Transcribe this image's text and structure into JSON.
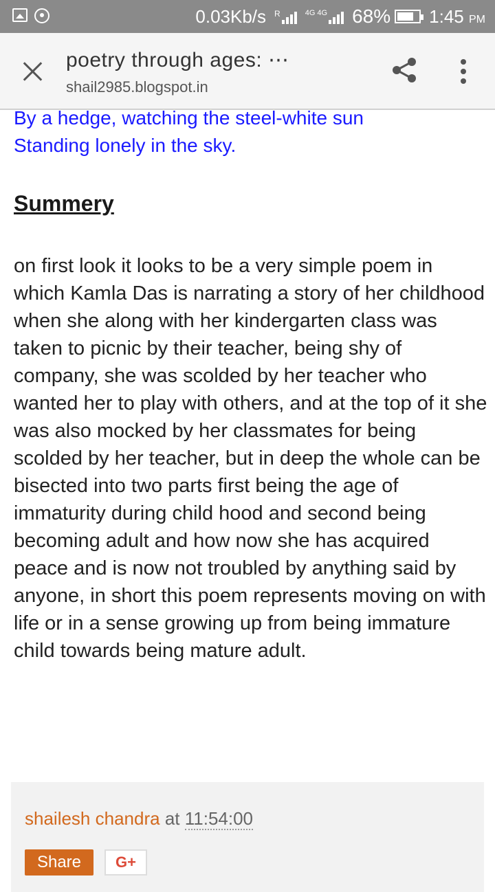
{
  "status_bar": {
    "speed": "0.03Kb/s",
    "sim1": "R",
    "sim2": "4G 4G",
    "battery": "68%",
    "battery_level": 0.68,
    "time": "1:45",
    "ampm": "PM",
    "icons": [
      "gallery-icon",
      "whatsapp-icon",
      "signal-icon",
      "battery-icon"
    ]
  },
  "header": {
    "title": "poetry through ages: ⋯",
    "url": "shail2985.blogspot.in",
    "icons": [
      "close-icon",
      "share-icon",
      "more-vert-icon"
    ]
  },
  "poem_lines": [
    "By a hedge, watching the steel-white sun",
    "Standing lonely in the sky."
  ],
  "section_title": "Summery",
  "summary": "on first look it looks to be a very simple poem in which Kamla Das is narrating a story of her childhood  when she along with her kindergarten class was taken to picnic by their teacher, being shy of company, she was scolded by her teacher who wanted her to play with others, and at the top of it she was also mocked by her classmates for being scolded by her teacher, but in deep the whole can be bisected into two parts first being the age of immaturity during child hood and second being becoming adult and how now she has acquired peace and is now not troubled by anything said by anyone, in short this poem represents moving on with life or in a sense growing up from being immature child towards being mature adult.",
  "footer": {
    "author": "shailesh chandra",
    "at": "at",
    "timestamp": "11:54:00",
    "share_label": "Share",
    "gplus_label": "G+"
  },
  "colors": {
    "poem": "#1a1aff",
    "author": "#d2691e",
    "share_button": "#d2691e",
    "status_bar": "#8a8a8a"
  }
}
